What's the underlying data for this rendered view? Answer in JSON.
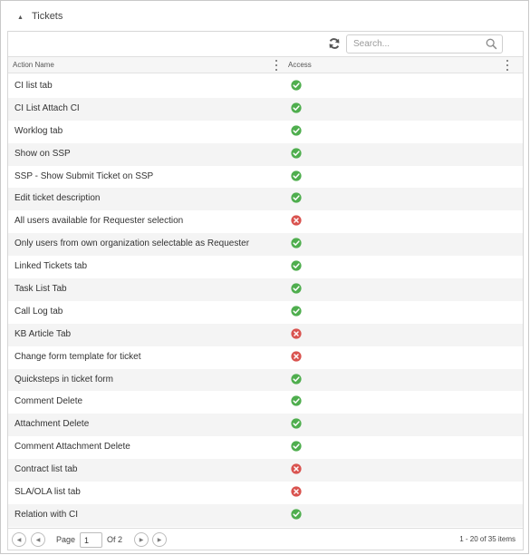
{
  "section": {
    "title": "Tickets",
    "collapse_glyph": "▲"
  },
  "toolbar": {
    "refresh_icon": "refresh-icon",
    "search_placeholder": "Search...",
    "search_value": "",
    "search_icon": "search-icon"
  },
  "columns": {
    "name": "Action Name",
    "access": "Access"
  },
  "status_colors": {
    "allowed": "#4fae4e",
    "denied": "#d9534f"
  },
  "rows": [
    {
      "name": "CI list tab",
      "access": "allowed"
    },
    {
      "name": "CI List Attach CI",
      "access": "allowed"
    },
    {
      "name": "Worklog tab",
      "access": "allowed"
    },
    {
      "name": "Show on SSP",
      "access": "allowed"
    },
    {
      "name": "SSP - Show Submit Ticket on SSP",
      "access": "allowed"
    },
    {
      "name": "Edit ticket description",
      "access": "allowed"
    },
    {
      "name": "All users available for Requester selection",
      "access": "denied"
    },
    {
      "name": "Only users from own organization selectable as Requester",
      "access": "allowed"
    },
    {
      "name": "Linked Tickets tab",
      "access": "allowed"
    },
    {
      "name": "Task List Tab",
      "access": "allowed"
    },
    {
      "name": "Call Log tab",
      "access": "allowed"
    },
    {
      "name": "KB Article Tab",
      "access": "denied"
    },
    {
      "name": "Change form template for ticket",
      "access": "denied"
    },
    {
      "name": "Quicksteps in ticket form",
      "access": "allowed"
    },
    {
      "name": "Comment Delete",
      "access": "allowed"
    },
    {
      "name": "Attachment Delete",
      "access": "allowed"
    },
    {
      "name": "Comment Attachment Delete",
      "access": "allowed"
    },
    {
      "name": "Contract list tab",
      "access": "denied"
    },
    {
      "name": "SLA/OLA list tab",
      "access": "denied"
    },
    {
      "name": "Relation with CI",
      "access": "allowed"
    }
  ],
  "pager": {
    "page_label": "Page",
    "current_page": "1",
    "of_label": "Of 2",
    "items_info": "1 - 20 of 35 items",
    "first_glyph": "◀",
    "prev_glyph": "◀",
    "next_glyph": "▶",
    "last_glyph": "▶"
  }
}
